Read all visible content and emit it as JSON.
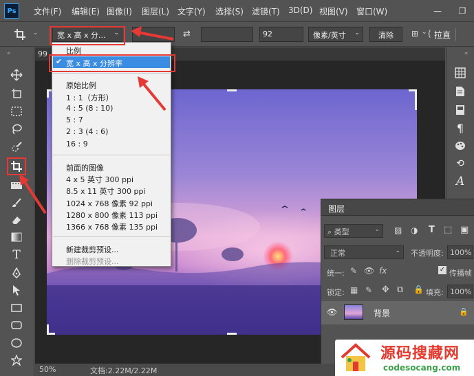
{
  "app": {
    "logo": "Ps"
  },
  "menubar": {
    "items": [
      "文件(F)",
      "编辑(E)",
      "图像(I)",
      "图层(L)",
      "文字(Y)",
      "选择(S)",
      "滤镜(T)",
      "3D(D)",
      "视图(V)",
      "窗口(W)"
    ],
    "minimize": "—",
    "restore": "❐"
  },
  "options": {
    "ratio_select": "宽 x 高 x 分...",
    "value_field": "92",
    "unit_select": "像素/英寸",
    "clear_button": "清除",
    "straighten_label": "拉直"
  },
  "doc_tab": {
    "label": "99"
  },
  "crop_menu": {
    "header": "比例",
    "selected": "宽 x 高 x 分辨率",
    "groups": [
      [
        "原始比例",
        "1 : 1（方形）",
        "4 : 5 (8 : 10)",
        "5 : 7",
        "2 : 3 (4 : 6)",
        "16 : 9"
      ],
      [
        "前面的图像",
        "4 x 5 英寸 300 ppi",
        "8.5 x 11 英寸 300 ppi",
        "1024 x 768 像素 92 ppi",
        "1280 x 800 像素 113 ppi",
        "1366 x 768 像素 135 ppi"
      ],
      [
        "新建裁剪预设...",
        "删除裁剪预设..."
      ]
    ]
  },
  "status": {
    "zoom": "50%",
    "doc": "文档:2.22M/2.22M"
  },
  "layers_panel": {
    "title": "图层",
    "filter_kind": "类型",
    "blend_mode": "正常",
    "opacity_label": "不透明度:",
    "opacity_value": "100%",
    "unify_label": "统一:",
    "propagate_label": "传播帧",
    "lock_label": "锁定:",
    "fill_label": "填充:",
    "fill_value": "100%",
    "layer_name": "背景"
  },
  "watermark": {
    "title": "源码搜藏网",
    "url": "codesocang.com"
  },
  "colors": {
    "accent": "#e53935",
    "selection": "#3b8ce3",
    "ps_blue": "#31a8ff"
  }
}
